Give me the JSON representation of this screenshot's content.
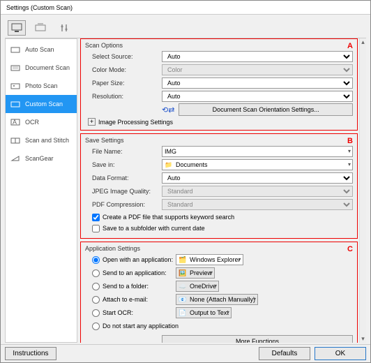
{
  "window": {
    "title": "Settings (Custom Scan)"
  },
  "sidebar": {
    "items": [
      {
        "label": "Auto Scan"
      },
      {
        "label": "Document Scan"
      },
      {
        "label": "Photo Scan"
      },
      {
        "label": "Custom Scan"
      },
      {
        "label": "OCR"
      },
      {
        "label": "Scan and Stitch"
      },
      {
        "label": "ScanGear"
      }
    ]
  },
  "scan_options": {
    "title": "Scan Options",
    "letter": "A",
    "select_source_label": "Select Source:",
    "select_source_value": "Auto",
    "color_mode_label": "Color Mode:",
    "color_mode_value": "Color",
    "paper_size_label": "Paper Size:",
    "paper_size_value": "Auto",
    "resolution_label": "Resolution:",
    "resolution_value": "Auto",
    "orientation_btn": "Document Scan Orientation Settings...",
    "image_proc": "Image Processing Settings"
  },
  "save_settings": {
    "title": "Save Settings",
    "letter": "B",
    "file_name_label": "File Name:",
    "file_name_value": "IMG",
    "save_in_label": "Save in:",
    "save_in_value": "Documents",
    "data_format_label": "Data Format:",
    "data_format_value": "Auto",
    "jpeg_quality_label": "JPEG Image Quality:",
    "jpeg_quality_value": "Standard",
    "pdf_compression_label": "PDF Compression:",
    "pdf_compression_value": "Standard",
    "chk_pdf_keyword": "Create a PDF file that supports keyword search",
    "chk_subfolder": "Save to a subfolder with current date"
  },
  "app_settings": {
    "title": "Application Settings",
    "letter": "C",
    "open_with_label": "Open with an application:",
    "open_with_value": "Windows Explorer",
    "send_app_label": "Send to an application:",
    "send_app_value": "Preview",
    "send_folder_label": "Send to a folder:",
    "send_folder_value": "OneDrive",
    "attach_email_label": "Attach to e-mail:",
    "attach_email_value": "None (Attach Manually)",
    "start_ocr_label": "Start OCR:",
    "start_ocr_value": "Output to Text",
    "no_start_label": "Do not start any application",
    "more_functions": "More Functions"
  },
  "footer": {
    "instructions": "Instructions",
    "defaults": "Defaults",
    "ok": "OK"
  }
}
